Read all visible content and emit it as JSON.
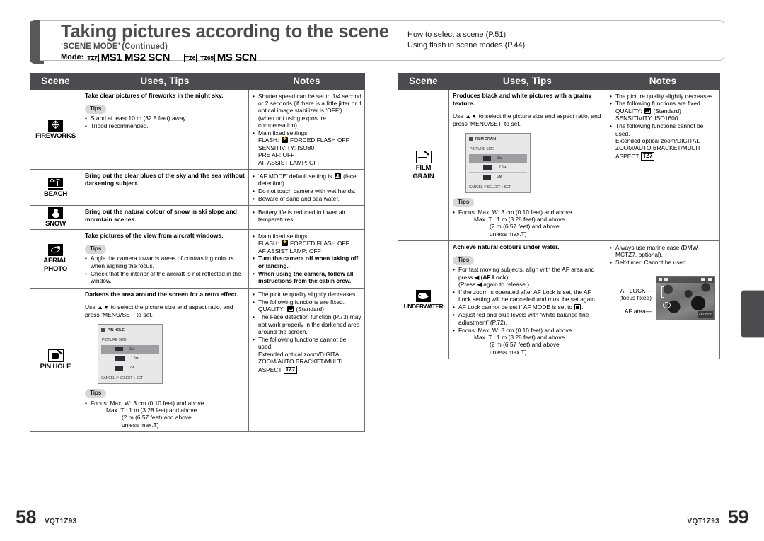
{
  "header": {
    "title": "Taking pictures according to the scene",
    "subtitle": "‘SCENE MODE’ (Continued)",
    "mode_label": "Mode:",
    "mode_tz7": "TZ7",
    "mode_tz7_text": "MS1 MS2 SCN",
    "mode_tz6": "TZ6",
    "mode_tz65": "TZ65",
    "mode_tz6_text": "MS SCN",
    "links": {
      "line1": "How to select a scene (P.51)",
      "line2": "Using flash in scene modes (P.44)"
    }
  },
  "columns": {
    "scene": "Scene",
    "uses_tips": "Uses, Tips",
    "notes": "Notes"
  },
  "left_table": {
    "fireworks": {
      "icon": "fireworks-icon",
      "name": "FIREWORKS",
      "lead": "Take clear pictures of fireworks in the night sky.",
      "tips_label": "Tips",
      "tips": [
        "Stand at least 10 m (32.8 feet) away.",
        "Tripod recommended."
      ],
      "notes": [
        "Shutter speed can be set to 1/4 second or 2 seconds (if there is a little jitter or if optical image stabilizer is ‘OFF’). (when not using exposure compensation)",
        "Main fixed settings"
      ],
      "notes_sub": [
        "FLASH: FORCED FLASH OFF",
        "SENSITIVITY: ISO80",
        "PRE AF: OFF",
        "AF ASSIST LAMP: OFF"
      ]
    },
    "beach": {
      "icon": "beach-icon",
      "name": "BEACH",
      "lead": "Bring out the clear blues of the sky and the sea without darkening subject.",
      "notes": [
        "‘AF MODE’ default setting is (face detection).",
        "Do not touch camera with wet hands.",
        "Beware of sand and sea water."
      ]
    },
    "snow": {
      "icon": "snow-icon",
      "name": "SNOW",
      "lead": "Bring out the natural colour of snow in ski slope and mountain scenes.",
      "notes": [
        "Battery life is reduced in lower air temperatures."
      ]
    },
    "aerial": {
      "icon": "aerial-photo-icon",
      "name_line1": "AERIAL",
      "name_line2": "PHOTO",
      "lead": "Take pictures of the view from aircraft windows.",
      "tips_label": "Tips",
      "tips": [
        "Angle the camera towards areas of contrasting colours when aligning the focus.",
        "Check that the interior of the aircraft is not reflected in the window."
      ],
      "notes_first": "Main fixed settings",
      "notes_sub": [
        "FLASH: FORCED FLASH OFF",
        "AF ASSIST LAMP: OFF"
      ],
      "notes_bold": [
        "Turn the camera off when taking off or landing.",
        "When using the camera, follow all instructions from the cabin crew."
      ]
    },
    "pinhole": {
      "icon": "pin-hole-icon",
      "name": "PIN HOLE",
      "lead": "Darkens the area around the screen for a retro effect.",
      "para": "Use ▲▼ to select the picture size and aspect ratio, and press ‘MENU/SET’ to set.",
      "screen": {
        "title": "PIN HOLE",
        "subtitle": "PICTURE SIZE",
        "rows": [
          {
            "label": "",
            "value": "3м"
          },
          {
            "label": "",
            "value": "1.5м"
          },
          {
            "label": "",
            "value": "2м"
          }
        ],
        "footer": "CANCEL ⏎ SELECT ‹› SET"
      },
      "tips_label": "Tips",
      "tips_focus": [
        "Focus: Max. W: 3 cm (0.10 feet) and above",
        "Max. T : 1 m (3.28 feet) and above",
        "(2 m (6.57 feet) and above",
        "unless max.T)"
      ],
      "notes": [
        "The picture quality slightly decreases.",
        "The following functions are fixed.",
        "The Face detection function (P.73) may not work properly in the darkened area around the screen.",
        "The following functions cannot be used."
      ],
      "notes_quality": "QUALITY: (Standard)",
      "notes_cannot": "Extended optical zoom/DIGITAL ZOOM/AUTO BRACKET/MULTI ASPECT",
      "notes_tz": "TZ7"
    }
  },
  "right_table": {
    "filmgrain": {
      "icon": "film-grain-icon",
      "name_line1": "FILM",
      "name_line2": "GRAIN",
      "lead": "Produces black and white pictures with a grainy texture.",
      "para": "Use ▲▼ to select the picture size and aspect ratio, and press ‘MENU/SET’ to set.",
      "screen": {
        "title": "FILM GRAIN",
        "subtitle": "PICTURE SIZE",
        "rows": [
          {
            "label": "",
            "value": "3м"
          },
          {
            "label": "",
            "value": "2.5м"
          },
          {
            "label": "",
            "value": "2м"
          }
        ],
        "footer": "CANCEL ⏎ SELECT ‹› SET"
      },
      "tips_label": "Tips",
      "tips_focus": [
        "Focus: Max. W: 3 cm (0.10 feet) and above",
        "Max. T : 1 m (3.28 feet) and above",
        "(2 m (6.57 feet) and above",
        "unless max.T)"
      ],
      "notes": [
        "The picture quality slightly decreases.",
        "The following functions are fixed.",
        "The following functions cannot be used."
      ],
      "notes_quality": "QUALITY: (Standard)",
      "notes_sensitivity": "SENSITIVITY: ISO1600",
      "notes_cannot": "Extended optical zoom/DIGITAL ZOOM/AUTO BRACKET/MULTI ASPECT",
      "notes_tz": "TZ7"
    },
    "underwater": {
      "icon": "underwater-icon",
      "name": "UNDERWATER",
      "lead": "Achieve natural colours under water.",
      "tips_label": "Tips",
      "tips": [
        "For fast moving subjects, align with the AF area and press ◀ (AF Lock).",
        "(Press ◀ again to release.)",
        "If the zoom is operated after AF Lock is set, the AF Lock setting will be cancelled and must be set again.",
        "AF Lock cannot be set if AF MODE is set to .",
        "Adjust red and blue levels with ‘white balance fine adjustment’ (P.72).",
        "Focus: Max. W: 3 cm (0.10 feet) and above"
      ],
      "tips_focus_extra": [
        "Max. T : 1 m (3.28 feet) and above",
        "(2 m (6.57 feet) and above",
        "unless max.T)"
      ],
      "notes": [
        "Always use marine case (DMW-MCTZ7, optional).",
        "Self-timer: Cannot be used"
      ],
      "af_labels": {
        "lock_line1": "AF LOCK",
        "lock_line2": "(focus fixed)",
        "area": "AF area",
        "badge": "AF LOCK"
      }
    }
  },
  "footer": {
    "left_page": "58",
    "left_code": "VQT1Z93",
    "right_code": "VQT1Z93",
    "right_page": "59"
  }
}
